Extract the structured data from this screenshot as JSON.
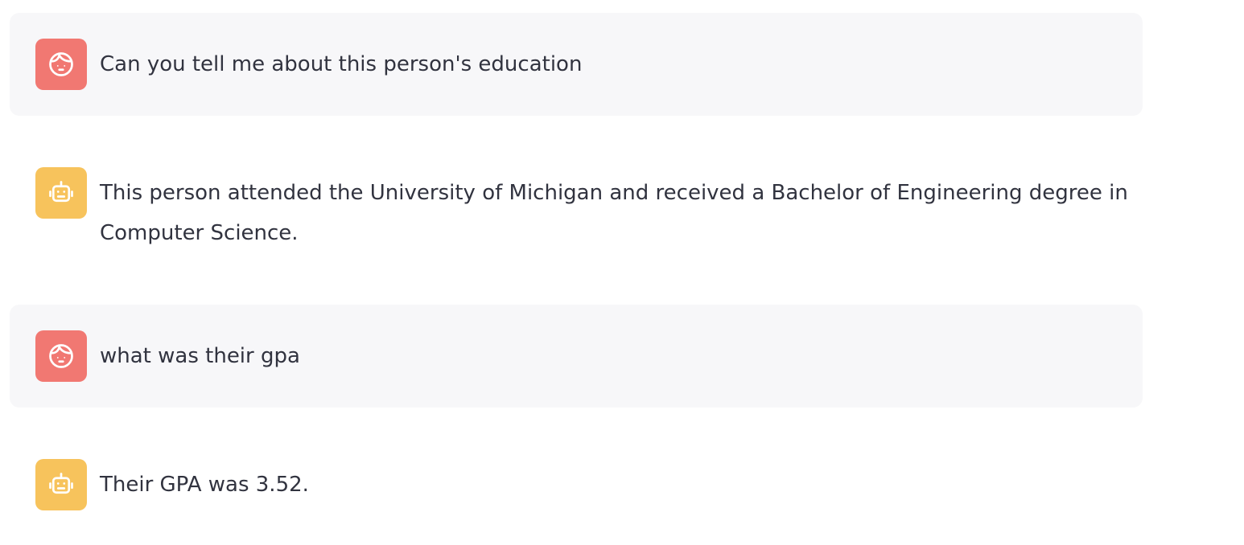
{
  "colors": {
    "user_avatar": "#f17872",
    "assistant_avatar": "#f7c35c",
    "user_bubble": "#f7f7f9",
    "text": "#31333f"
  },
  "messages": [
    {
      "role": "user",
      "avatar_icon": "face-icon",
      "text": "Can you tell me about this person's education"
    },
    {
      "role": "assistant",
      "avatar_icon": "robot-icon",
      "text": "This person attended the University of Michigan and received a Bachelor of Engineering degree in Computer Science."
    },
    {
      "role": "user",
      "avatar_icon": "face-icon",
      "text": "what was their gpa"
    },
    {
      "role": "assistant",
      "avatar_icon": "robot-icon",
      "text": "Their GPA was 3.52."
    }
  ]
}
